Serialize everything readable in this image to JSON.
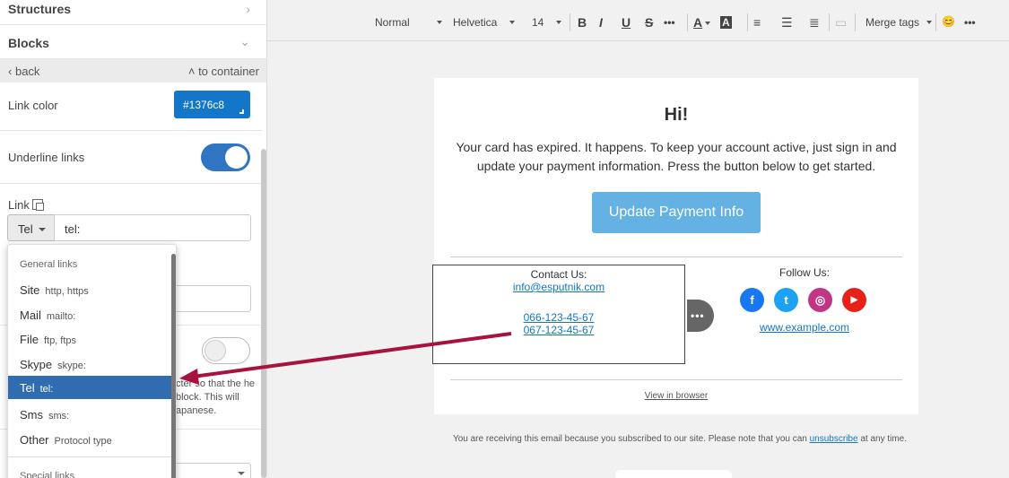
{
  "left_panel": {
    "structures_label": "Structures",
    "blocks_label": "Blocks",
    "back_label": "back",
    "to_container_label": "to container",
    "link_color_label": "Link color",
    "link_color_value": "#1376c8",
    "underline_links_label": "Underline links",
    "underline_links_on": true,
    "link_label": "Link",
    "link_type_value": "Tel",
    "link_input_value": "tel:",
    "help_text": "cter so that the he block. This will apanese."
  },
  "dropdown": {
    "general_header": "General links",
    "options": [
      {
        "label": "Site",
        "protocol": "http, https",
        "selected": false
      },
      {
        "label": "Mail",
        "protocol": "mailto:",
        "selected": false
      },
      {
        "label": "File",
        "protocol": "ftp, ftps",
        "selected": false
      },
      {
        "label": "Skype",
        "protocol": "skype:",
        "selected": false
      },
      {
        "label": "Tel",
        "protocol": "tel:",
        "selected": true
      },
      {
        "label": "Sms",
        "protocol": "sms:",
        "selected": false
      },
      {
        "label": "Other",
        "protocol": "Protocol type",
        "selected": false
      }
    ],
    "special_header": "Special links"
  },
  "toolbar": {
    "format": "Normal",
    "font": "Helvetica",
    "size": "14",
    "bold": "B",
    "italic": "I",
    "underline": "U",
    "strike": "S",
    "more": "•••",
    "text_color": "A",
    "bg_color": "A",
    "merge_tags": "Merge tags",
    "emoji": "😊"
  },
  "email": {
    "title": "Hi!",
    "body": "Your card has expired. It happens. To keep your account active, just sign in and update your payment information. Press the button below to get started.",
    "cta_label": "Update Payment Info",
    "contact_title": "Contact Us:",
    "contact_email": "info@esputnik.com",
    "phone_1": "066-123-45-67",
    "phone_2": "067-123-45-67",
    "more_label": "•••",
    "follow_title": "Follow Us:",
    "site_link": "www.example.com",
    "view_in_browser": "View in browser",
    "footer_text": "You are receiving this email because you subscribed to our site. Please note that you can",
    "unsubscribe": "unsubscribe",
    "footer_end": "at any time."
  },
  "colors": {
    "accent": "#1376c8",
    "toggle": "#2f75c2",
    "selected_option": "#2f6db0",
    "cta": "#64b1e3",
    "arrow": "#a8123f",
    "facebook": "#1877f2",
    "twitter": "#1da1f2",
    "instagram": "#c13584",
    "youtube": "#e62117"
  },
  "socials": [
    {
      "name": "facebook-icon",
      "glyph": "f"
    },
    {
      "name": "twitter-icon",
      "glyph": "t"
    },
    {
      "name": "instagram-icon",
      "glyph": "◎"
    },
    {
      "name": "youtube-icon",
      "glyph": "▶"
    }
  ]
}
